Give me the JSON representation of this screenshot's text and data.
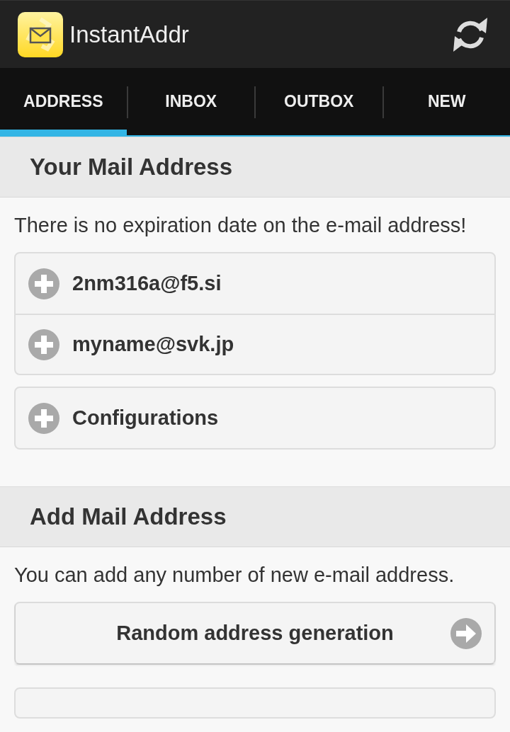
{
  "app_bar": {
    "title": "InstantAddr"
  },
  "tabs": [
    {
      "label": "ADDRESS",
      "selected": true
    },
    {
      "label": "INBOX",
      "selected": false
    },
    {
      "label": "OUTBOX",
      "selected": false
    },
    {
      "label": "NEW",
      "selected": false
    }
  ],
  "sections": [
    {
      "title": "Your Mail Address",
      "description": "There is no expiration date on the e-mail address!",
      "groups": [
        {
          "items": [
            {
              "label": "2nm316a@f5.si",
              "kind": "expand"
            },
            {
              "label": "myname@svk.jp",
              "kind": "expand"
            }
          ]
        },
        {
          "items": [
            {
              "label": "Configurations",
              "kind": "expand"
            }
          ]
        }
      ]
    },
    {
      "title": "Add Mail Address",
      "description": "You can add any number of new e-mail address.",
      "groups": [
        {
          "items": [
            {
              "label": "Random address generation",
              "kind": "action"
            }
          ]
        }
      ]
    }
  ]
}
